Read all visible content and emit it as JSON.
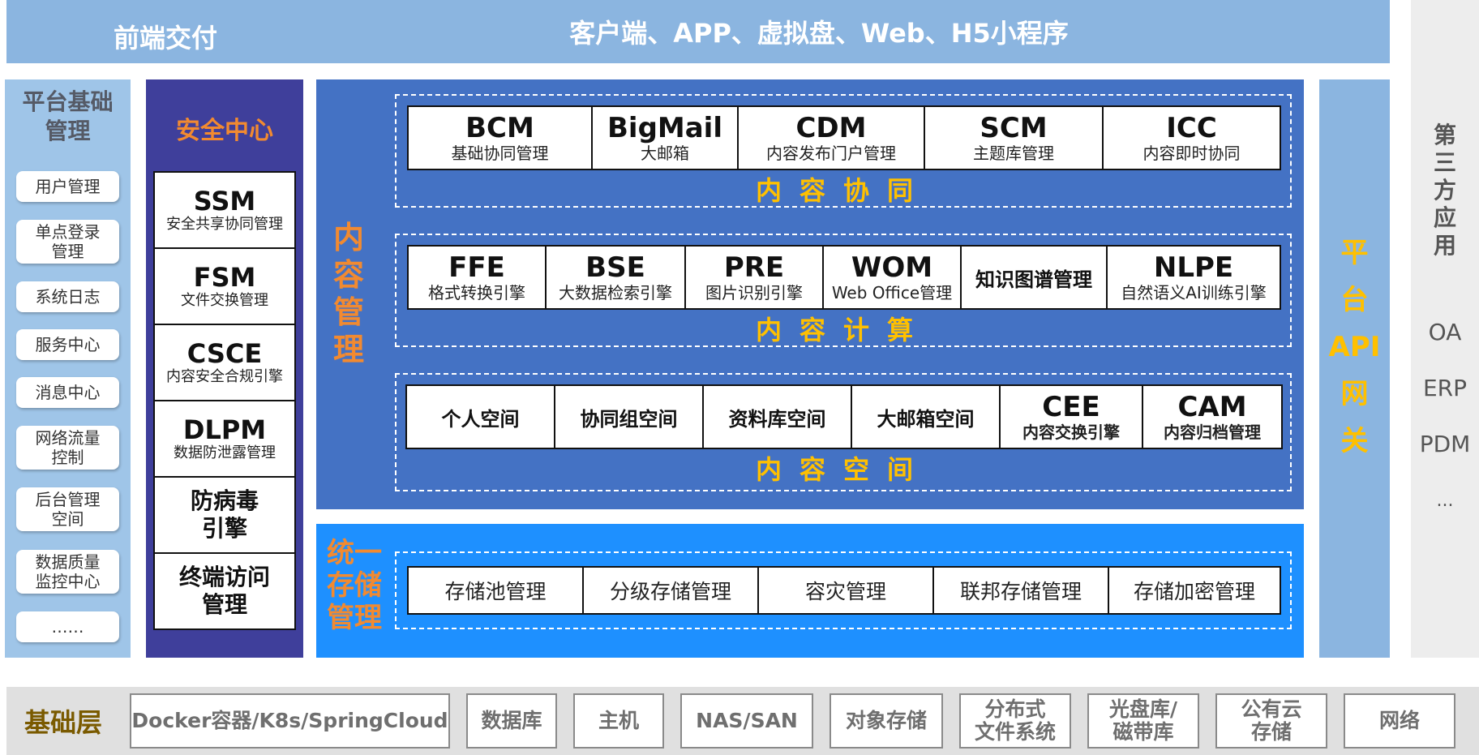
{
  "top": {
    "left_label": "前端交付",
    "main_label": "客户端、APP、虚拟盘、Web、H5小程序"
  },
  "platform": {
    "title_line1": "平台基础",
    "title_line2": "管理",
    "items": [
      {
        "line1": "用户管理",
        "line2": ""
      },
      {
        "line1": "单点登录",
        "line2": "管理"
      },
      {
        "line1": "系统日志",
        "line2": ""
      },
      {
        "line1": "服务中心",
        "line2": ""
      },
      {
        "line1": "消息中心",
        "line2": ""
      },
      {
        "line1": "网络流量",
        "line2": "控制"
      },
      {
        "line1": "后台管理",
        "line2": "空间"
      },
      {
        "line1": "数据质量",
        "line2": "监控中心"
      },
      {
        "line1": "……",
        "line2": ""
      }
    ]
  },
  "security": {
    "title": "安全中心",
    "items": [
      {
        "code": "SSM",
        "desc": "安全共享协同管理"
      },
      {
        "code": "FSM",
        "desc": "文件交换管理"
      },
      {
        "code": "CSCE",
        "desc": "内容安全合规引擎"
      },
      {
        "code": "DLPM",
        "desc": "数据防泄露管理"
      },
      {
        "line1": "防病毒",
        "line2": "引擎"
      },
      {
        "line1": "终端访问",
        "line2": "管理"
      }
    ]
  },
  "content": {
    "label": [
      "内",
      "容",
      "管",
      "理"
    ],
    "collab": {
      "label": "内容协同",
      "items": [
        {
          "code": "BCM",
          "desc": "基础协同管理"
        },
        {
          "code": "BigMail",
          "desc": "大邮箱"
        },
        {
          "code": "CDM",
          "desc": "内容发布门户管理"
        },
        {
          "code": "SCM",
          "desc": "主题库管理"
        },
        {
          "code": "ICC",
          "desc": "内容即时协同"
        }
      ]
    },
    "compute": {
      "label": "内容计算",
      "items": [
        {
          "code": "FFE",
          "desc": "格式转换引擎"
        },
        {
          "code": "BSE",
          "desc": "大数据检索引擎"
        },
        {
          "code": "PRE",
          "desc": "图片识别引擎"
        },
        {
          "code": "WOM",
          "desc": "Web Office管理"
        },
        {
          "plain": "知识图谱管理"
        },
        {
          "code": "NLPE",
          "desc": "自然语义AI训练引擎"
        }
      ]
    },
    "space": {
      "label": "内容空间",
      "items": [
        {
          "plain": "个人空间"
        },
        {
          "plain": "协同组空间"
        },
        {
          "plain": "资料库空间"
        },
        {
          "plain": "大邮箱空间"
        },
        {
          "code": "CEE",
          "desc": "内容交换引擎"
        },
        {
          "code": "CAM",
          "desc": "内容归档管理"
        }
      ]
    }
  },
  "storage": {
    "label": [
      "统一",
      "存储",
      "管理"
    ],
    "items": [
      "存储池管理",
      "分级存储管理",
      "容灾管理",
      "联邦存储管理",
      "存储加密管理"
    ]
  },
  "api": {
    "label": [
      "平",
      "台",
      "API",
      "网",
      "关"
    ]
  },
  "third_party": {
    "title": [
      "第",
      "三",
      "方",
      "应",
      "用"
    ],
    "items": [
      "OA",
      "ERP",
      "PDM",
      "..."
    ]
  },
  "base": {
    "title": "基础层",
    "items": [
      {
        "line1": "Docker容器/K8s/SpringCloud",
        "line2": ""
      },
      {
        "line1": "数据库",
        "line2": ""
      },
      {
        "line1": "主机",
        "line2": ""
      },
      {
        "line1": "NAS/SAN",
        "line2": ""
      },
      {
        "line1": "对象存储",
        "line2": ""
      },
      {
        "line1": "分布式",
        "line2": "文件系统"
      },
      {
        "line1": "光盘库/",
        "line2": "磁带库"
      },
      {
        "line1": "公有云",
        "line2": "存储"
      },
      {
        "line1": "网络",
        "line2": ""
      }
    ]
  }
}
